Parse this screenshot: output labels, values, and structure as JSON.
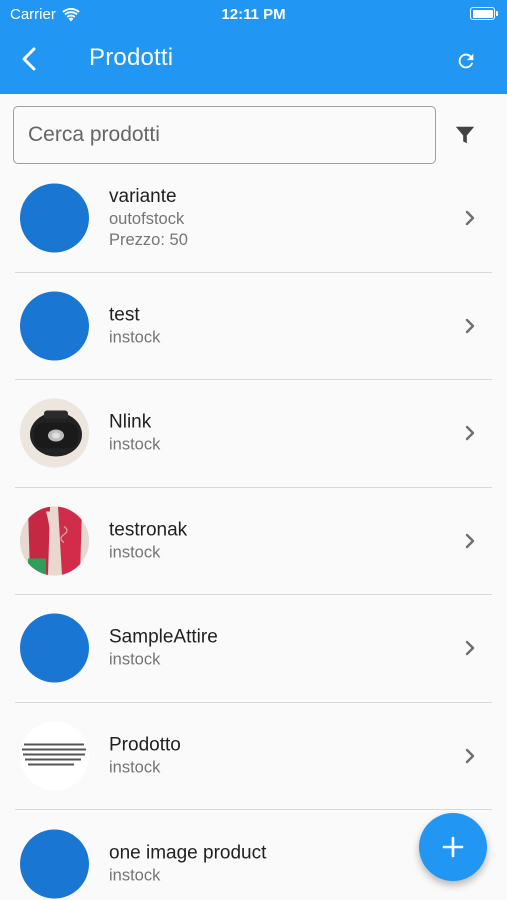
{
  "status_bar": {
    "carrier": "Carrier",
    "time": "12:11 PM",
    "wifi_icon": "wifi-icon",
    "battery_icon": "battery-icon"
  },
  "app_bar": {
    "title": "Prodotti",
    "back_icon": "chevron-left-icon",
    "refresh_icon": "refresh-icon",
    "color": "#2196f3"
  },
  "search": {
    "placeholder": "Cerca prodotti",
    "value": ""
  },
  "filter_icon": "filter-icon",
  "products": [
    {
      "name": "variante",
      "status": "outofstock",
      "price": "Prezzo: 50",
      "image": "placeholder"
    },
    {
      "name": "test",
      "status": "instock",
      "image": "placeholder"
    },
    {
      "name": "Nlink",
      "status": "instock",
      "image": "black-product-photo"
    },
    {
      "name": "testronak",
      "status": "instock",
      "image": "red-fabric-photo"
    },
    {
      "name": "SampleAttire",
      "status": "instock",
      "image": "placeholder"
    },
    {
      "name": "Prodotto",
      "status": "instock",
      "image": "text-snippet"
    },
    {
      "name": "one image product",
      "status": "instock",
      "image": "placeholder"
    }
  ],
  "fab": {
    "icon": "plus-icon",
    "color": "#2196f3"
  },
  "colors": {
    "placeholder_avatar": "#1976d2",
    "secondary_text": "#757575"
  }
}
